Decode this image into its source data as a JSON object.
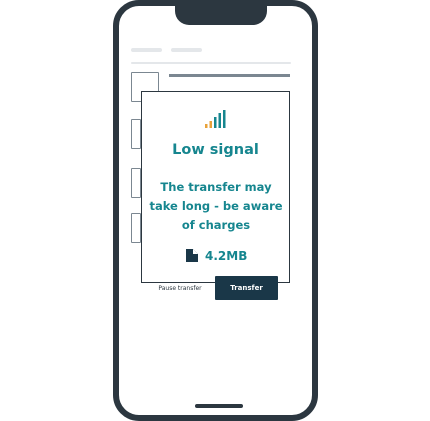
{
  "dialog": {
    "title": "Low signal",
    "message": "The transfer may take long - be aware of charges",
    "file_size": "4.2MB",
    "pause_label": "Pause transfer",
    "transfer_label": "Transfer"
  },
  "icons": {
    "signal": "signal-bars-icon",
    "file": "file-icon"
  },
  "colors": {
    "accent": "#16868f",
    "primary_button": "#1a3748",
    "device_frame": "#2c3740",
    "signal_weak": "#e8a23a"
  }
}
